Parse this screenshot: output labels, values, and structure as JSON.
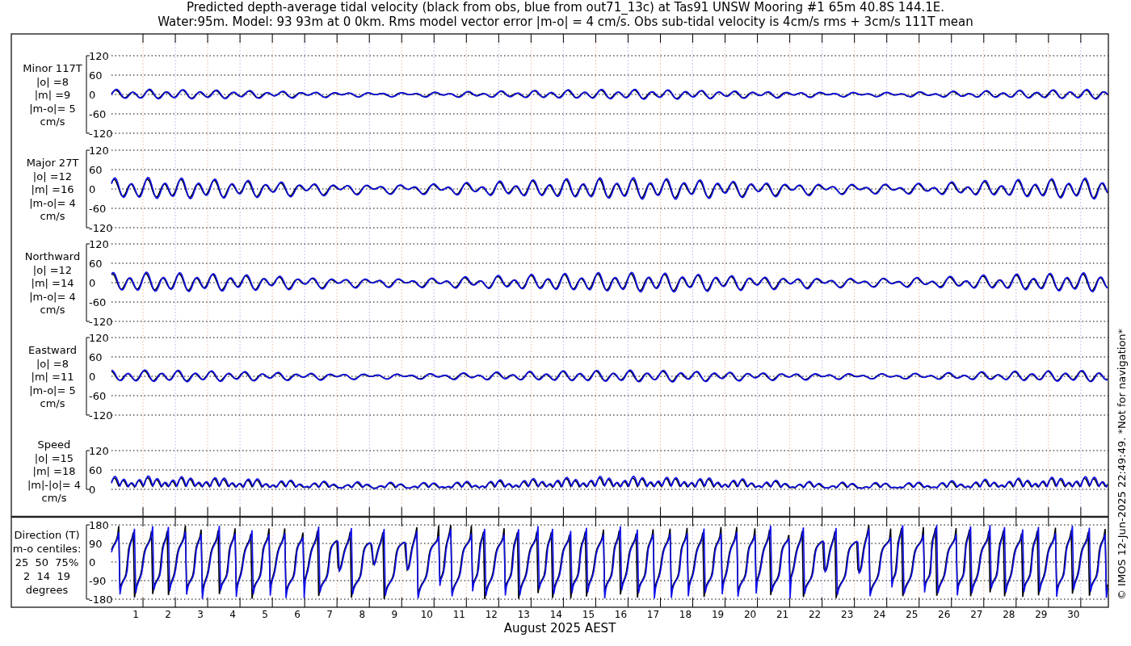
{
  "title": [
    "Predicted depth-average tidal velocity (black from obs, blue from out71_13c) at Tas91 UNSW Mooring #1 65m 40.8S 144.1E.",
    "Water:95m. Model: 93 93m at 0 0km. Rms model vector error |m-o| = 4 cm/s. Obs sub-tidal velocity is 4cm/s rms + 3cm/s 111T mean"
  ],
  "panels": [
    {
      "kind": "signed",
      "label_lines": [
        "Minor 117T",
        "|o| =8",
        "|m| =9",
        "|m-o|= 5",
        "cm/s"
      ],
      "yticks": [
        "120",
        "60",
        "0",
        "-60",
        "-120"
      ]
    },
    {
      "kind": "signed",
      "label_lines": [
        "Major 27T",
        "|o| =12",
        "|m| =16",
        "|m-o|= 4",
        "cm/s"
      ],
      "yticks": [
        "120",
        "60",
        "0",
        "-60",
        "-120"
      ]
    },
    {
      "kind": "signed",
      "label_lines": [
        "Northward",
        "|o| =12",
        "|m| =14",
        "|m-o|= 4",
        "cm/s"
      ],
      "yticks": [
        "120",
        "60",
        "0",
        "-60",
        "-120"
      ]
    },
    {
      "kind": "signed",
      "label_lines": [
        "Eastward",
        "|o| =8",
        "|m| =11",
        "|m-o|= 5",
        "cm/s"
      ],
      "yticks": [
        "120",
        "60",
        "0",
        "-60",
        "-120"
      ]
    },
    {
      "kind": "speed",
      "label_lines": [
        "Speed",
        "|o| =15",
        "|m| =18",
        "|m|-|o|= 4",
        "cm/s"
      ],
      "yticks": [
        "120",
        "60",
        "0"
      ]
    },
    {
      "kind": "direction",
      "label_lines": [
        "Direction (T)",
        "m-o centiles:",
        "25  50  75%",
        "2  14  19",
        "degrees"
      ],
      "yticks": [
        "180",
        "90",
        "0",
        "-90",
        "-180"
      ]
    }
  ],
  "x_axis": {
    "days": [
      "1",
      "2",
      "3",
      "4",
      "5",
      "6",
      "7",
      "8",
      "9",
      "10",
      "11",
      "12",
      "13",
      "14",
      "15",
      "16",
      "17",
      "18",
      "19",
      "20",
      "21",
      "22",
      "23",
      "24",
      "25",
      "26",
      "27",
      "28",
      "29",
      "30"
    ],
    "xlabel": "August 2025 AEST"
  },
  "side_note": "© IMOS 12-Jun-2025 22:49:49. *Not for navigation*"
}
